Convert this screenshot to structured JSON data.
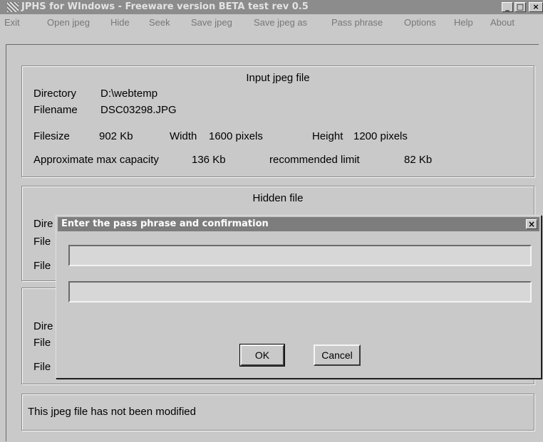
{
  "window": {
    "title": "JPHS for WIndows - Freeware version BETA test rev 0.5"
  },
  "menu": [
    "Exit",
    "Open jpeg",
    "Hide",
    "Seek",
    "Save jpeg",
    "Save jpeg as",
    "Pass phrase",
    "Options",
    "Help",
    "About"
  ],
  "input_group": {
    "title": "Input jpeg file",
    "directory_label": "Directory",
    "directory_value": "D:\\webtemp",
    "filename_label": "Filename",
    "filename_value": "DSC03298.JPG",
    "filesize_label": "Filesize",
    "filesize_value": "902  Kb",
    "width_label": "Width",
    "width_value": "1600  pixels",
    "height_label": "Height",
    "height_value": "1200  pixels",
    "capacity_label": "Approximate max capacity",
    "capacity_value": "136  Kb",
    "limit_label": "recommended limit",
    "limit_value": "82  Kb"
  },
  "hidden_group": {
    "title": "Hidden file",
    "dir_label_partial": "Dire",
    "file_label_partial_1": "File",
    "file_label_partial_2": "File"
  },
  "third_group": {
    "dir_label_partial": "Dire",
    "file_label_partial_1": "File",
    "file_label_partial_2": "File"
  },
  "status": {
    "text": "This jpeg file has not been modified"
  },
  "dialog": {
    "title": "Enter the pass phrase and confirmation",
    "passphrase_value": "",
    "confirmation_value": "",
    "ok_label": "OK",
    "cancel_label": "Cancel",
    "close_glyph": "×"
  },
  "titlebar_buttons": {
    "minimize": "_",
    "maximize": "□",
    "close": "×"
  }
}
